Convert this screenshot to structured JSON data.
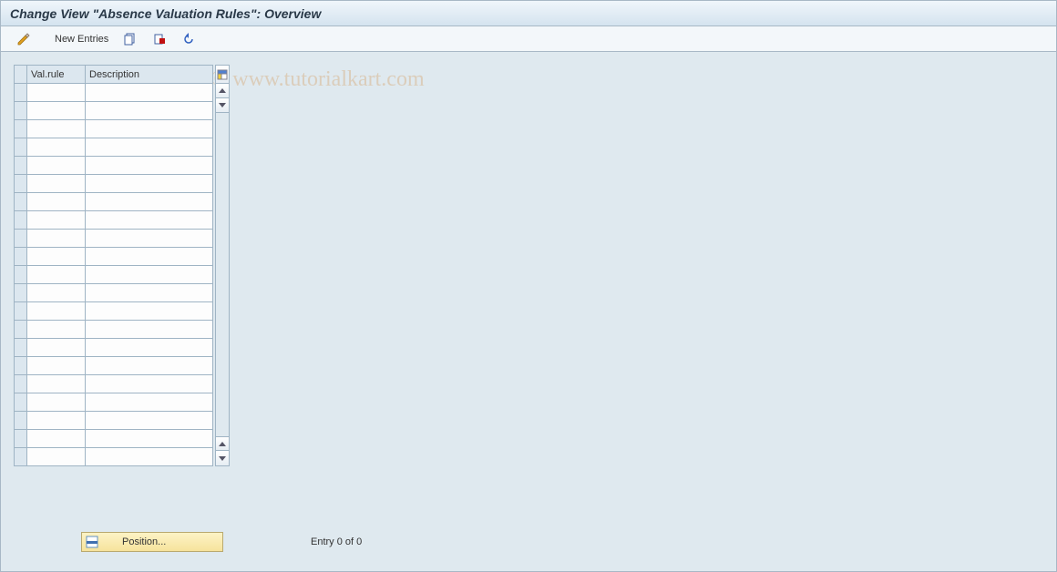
{
  "title": "Change View \"Absence Valuation Rules\": Overview",
  "toolbar": {
    "new_entries_label": "New Entries"
  },
  "columns": {
    "val_rule": "Val.rule",
    "description": "Description"
  },
  "rows_count": 21,
  "footer": {
    "position_label": "Position...",
    "entry_text": "Entry 0 of 0"
  },
  "watermark": "© www.tutorialkart.com"
}
